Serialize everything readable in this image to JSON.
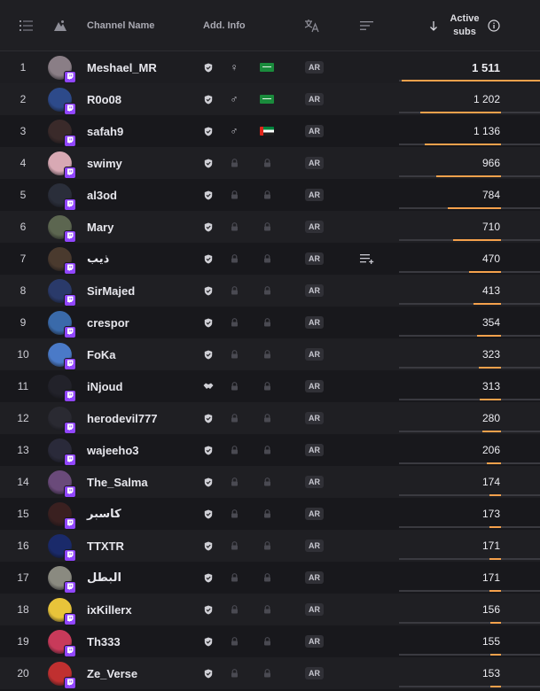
{
  "header": {
    "channel_name": "Channel Name",
    "add_info": "Add. Info",
    "active_subs_line1": "Active",
    "active_subs_line2": "subs"
  },
  "colors": {
    "accent_bar": "#f5a14c",
    "twitch_purple": "#9146ff"
  },
  "rows": [
    {
      "rank": "1",
      "name": "Meshael_MR",
      "gender": "♀",
      "flag": "sa",
      "lang": "AR",
      "subs": "1 511",
      "bar": 1.0,
      "locked": false
    },
    {
      "rank": "2",
      "name": "R0o08",
      "gender": "♂",
      "flag": "sa",
      "lang": "AR",
      "subs": "1 202",
      "bar": 0.795,
      "locked": false
    },
    {
      "rank": "3",
      "name": "safah9",
      "gender": "♂",
      "flag": "ae",
      "lang": "AR",
      "subs": "1 136",
      "bar": 0.752,
      "locked": false
    },
    {
      "rank": "4",
      "name": "swimy",
      "gender": "",
      "flag": "",
      "lang": "AR",
      "subs": "966",
      "bar": 0.639,
      "locked": true
    },
    {
      "rank": "5",
      "name": "al3od",
      "gender": "",
      "flag": "",
      "lang": "AR",
      "subs": "784",
      "bar": 0.519,
      "locked": true
    },
    {
      "rank": "6",
      "name": "Mary",
      "gender": "",
      "flag": "",
      "lang": "AR",
      "subs": "710",
      "bar": 0.47,
      "locked": true
    },
    {
      "rank": "7",
      "name": "ذيب",
      "gender": "",
      "flag": "",
      "lang": "AR",
      "subs": "470",
      "bar": 0.311,
      "locked": true,
      "add_to_list": true
    },
    {
      "rank": "8",
      "name": "SirMajed",
      "gender": "",
      "flag": "",
      "lang": "AR",
      "subs": "413",
      "bar": 0.273,
      "locked": true
    },
    {
      "rank": "9",
      "name": "crespor",
      "gender": "",
      "flag": "",
      "lang": "AR",
      "subs": "354",
      "bar": 0.234,
      "locked": true
    },
    {
      "rank": "10",
      "name": "FoKa",
      "gender": "",
      "flag": "",
      "lang": "AR",
      "subs": "323",
      "bar": 0.214,
      "locked": true
    },
    {
      "rank": "11",
      "name": "iNjoud",
      "gender": "",
      "flag": "",
      "lang": "AR",
      "subs": "313",
      "bar": 0.207,
      "locked": true,
      "partner_icon": "handshake"
    },
    {
      "rank": "12",
      "name": "herodevil777",
      "gender": "",
      "flag": "",
      "lang": "AR",
      "subs": "280",
      "bar": 0.185,
      "locked": true
    },
    {
      "rank": "13",
      "name": "wajeeho3",
      "gender": "",
      "flag": "",
      "lang": "AR",
      "subs": "206",
      "bar": 0.136,
      "locked": true
    },
    {
      "rank": "14",
      "name": "The_Salma",
      "gender": "",
      "flag": "",
      "lang": "AR",
      "subs": "174",
      "bar": 0.115,
      "locked": true
    },
    {
      "rank": "15",
      "name": "كاسبر",
      "gender": "",
      "flag": "",
      "lang": "AR",
      "subs": "173",
      "bar": 0.114,
      "locked": true
    },
    {
      "rank": "16",
      "name": "TTXTR",
      "gender": "",
      "flag": "",
      "lang": "AR",
      "subs": "171",
      "bar": 0.113,
      "locked": true
    },
    {
      "rank": "17",
      "name": "البطل",
      "gender": "",
      "flag": "",
      "lang": "AR",
      "subs": "171",
      "bar": 0.113,
      "locked": true
    },
    {
      "rank": "18",
      "name": "ixKillerx",
      "gender": "",
      "flag": "",
      "lang": "AR",
      "subs": "156",
      "bar": 0.103,
      "locked": true
    },
    {
      "rank": "19",
      "name": "Th333",
      "gender": "",
      "flag": "",
      "lang": "AR",
      "subs": "155",
      "bar": 0.103,
      "locked": true
    },
    {
      "rank": "20",
      "name": "Ze_Verse",
      "gender": "",
      "flag": "",
      "lang": "AR",
      "subs": "153",
      "bar": 0.101,
      "locked": true
    }
  ],
  "avatar_colors": [
    "#8a7e86",
    "#2d4a8a",
    "#3a2a2a",
    "#d8a9b4",
    "#2a2e3a",
    "#5c6650",
    "#4a3a2e",
    "#2a3a6a",
    "#3a6aaa",
    "#4a7ac8",
    "#22222a",
    "#2a2a32",
    "#2a2a3a",
    "#6a4a7a",
    "#3a2020",
    "#1a2a6a",
    "#8a8a80",
    "#e8c43a",
    "#c83a5a",
    "#c03030"
  ]
}
